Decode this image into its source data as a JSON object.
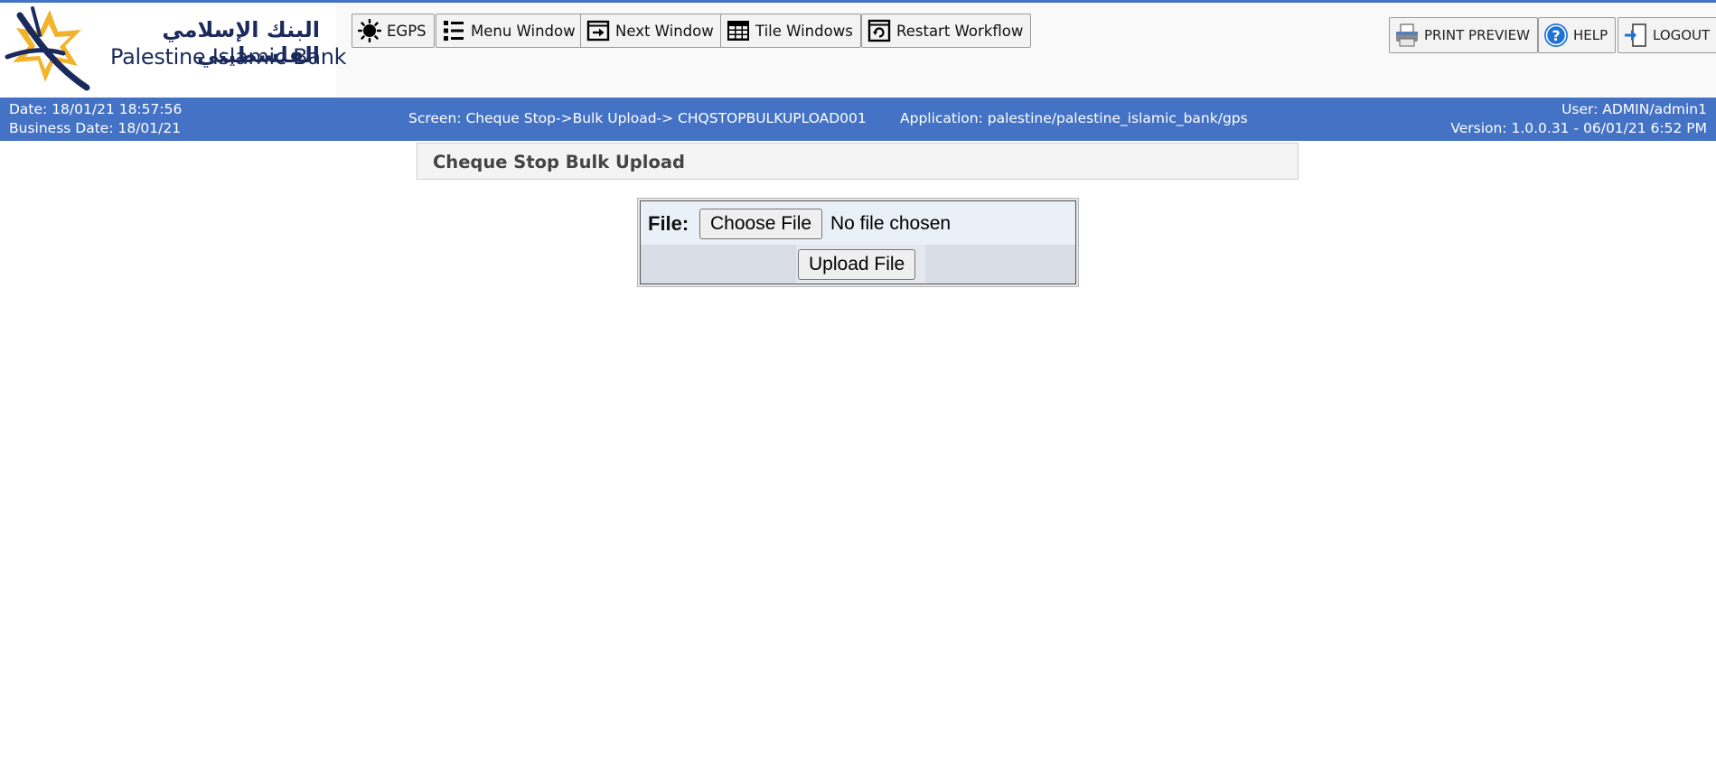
{
  "colors": {
    "accent_bar": "#4472c4",
    "logo_gold": "#f2b229",
    "logo_navy": "#1b2a5c",
    "help_blue": "#1f73d6"
  },
  "brand": {
    "name_arabic": "البنك الإسلامي الفلسطيني",
    "name_english": "Palestine Islamic Bank",
    "logo_icon": "star-logo-icon"
  },
  "toolbar": {
    "buttons": [
      {
        "label": "EGPS",
        "icon": "sun-icon"
      },
      {
        "label": "Menu Window",
        "icon": "list-icon"
      },
      {
        "label": "Next Window",
        "icon": "next-window-icon"
      },
      {
        "label": "Tile Windows",
        "icon": "tile-grid-icon"
      },
      {
        "label": "Restart Workflow",
        "icon": "restart-icon"
      }
    ],
    "right_buttons": [
      {
        "label": "PRINT PREVIEW",
        "icon": "printer-icon"
      },
      {
        "label": "HELP",
        "icon": "help-icon"
      },
      {
        "label": "LOGOUT",
        "icon": "logout-icon"
      }
    ]
  },
  "status_bar": {
    "date": "Date: 18/01/21 18:57:56",
    "business_date": "Business Date: 18/01/21",
    "screen": "Screen: Cheque Stop->Bulk Upload-> CHQSTOPBULKUPLOAD001",
    "application": "Application: palestine/palestine_islamic_bank/gps",
    "user": "User: ADMIN/admin1",
    "version": "Version: 1.0.0.31 - 06/01/21 6:52 PM"
  },
  "panel": {
    "title": "Cheque Stop Bulk Upload"
  },
  "upload_form": {
    "file_label": "File:",
    "choose_button": "Choose File",
    "no_file_text": "No file chosen",
    "upload_button": "Upload File"
  }
}
